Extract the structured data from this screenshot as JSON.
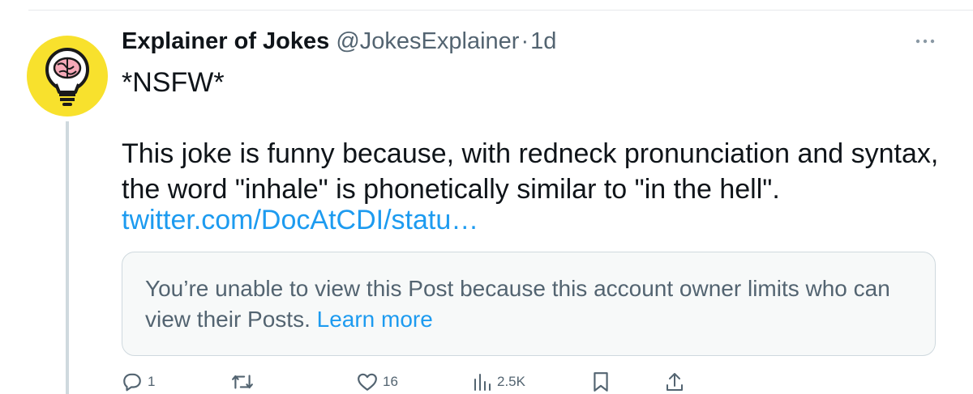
{
  "post": {
    "author_name": "Explainer of Jokes",
    "handle": "@JokesExplainer",
    "separator": "·",
    "time": "1d",
    "text": "*NSFW*\n\nThis joke is funny because, with redneck pronunciation and syntax, the word \"inhale\" is phonetically similar to \"in the hell\".",
    "link_text": "twitter.com/DocAtCDI/statu…"
  },
  "notice": {
    "text": "You’re unable to view this Post because this account owner limits who can view their Posts. ",
    "link_text": "Learn more"
  },
  "actions": {
    "reply_count": "1",
    "like_count": "16",
    "views_count": "2.5K"
  },
  "colors": {
    "avatar_bg": "#f8e12d",
    "link": "#1d9bf0",
    "muted": "#536471",
    "card_bg": "#f7f9f9"
  },
  "icons": [
    "lightbulb-brain-icon",
    "more-icon",
    "reply-icon",
    "retweet-icon",
    "like-icon",
    "views-icon",
    "bookmark-icon",
    "share-icon"
  ]
}
